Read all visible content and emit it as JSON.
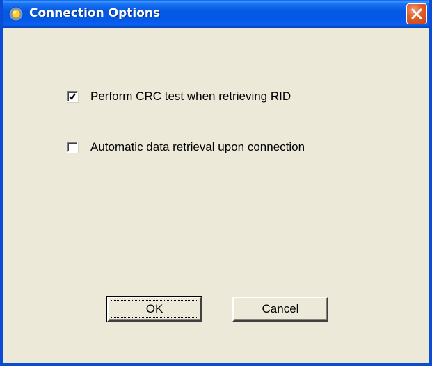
{
  "window": {
    "title": "Connection Options",
    "icon": "app-sun-icon"
  },
  "options": [
    {
      "label": "Perform CRC test when retrieving RID",
      "checked": true
    },
    {
      "label": "Automatic data retrieval upon connection",
      "checked": false
    }
  ],
  "buttons": {
    "ok_label": "OK",
    "cancel_label": "Cancel"
  },
  "colors": {
    "titlebar": "#0558e0",
    "face": "#ece9d8",
    "close": "#e0602a"
  }
}
